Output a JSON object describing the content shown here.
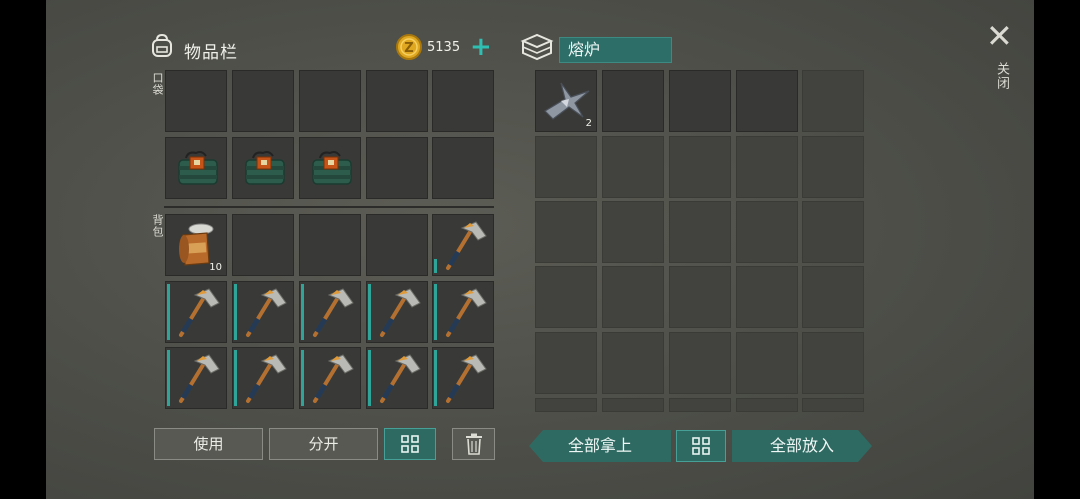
{
  "inventory": {
    "title": "物品栏",
    "coins": "5135",
    "pocket_label": "口袋",
    "backpack_label": "背包",
    "pocket_items": [
      {
        "slot": 5,
        "item": "explosive-pack"
      },
      {
        "slot": 6,
        "item": "explosive-pack"
      },
      {
        "slot": 7,
        "item": "explosive-pack"
      }
    ],
    "can_count": "10"
  },
  "furnace": {
    "title": "熔炉",
    "item_count": "2"
  },
  "close": {
    "label": "关闭"
  },
  "buttons": {
    "use": "使用",
    "split": "分开",
    "take_all": "全部拿上",
    "put_all": "全部放入"
  },
  "colors": {
    "accent_teal": "#2f6a62",
    "plus_teal": "#2fbfb2",
    "coin_gold": "#e0a820"
  }
}
